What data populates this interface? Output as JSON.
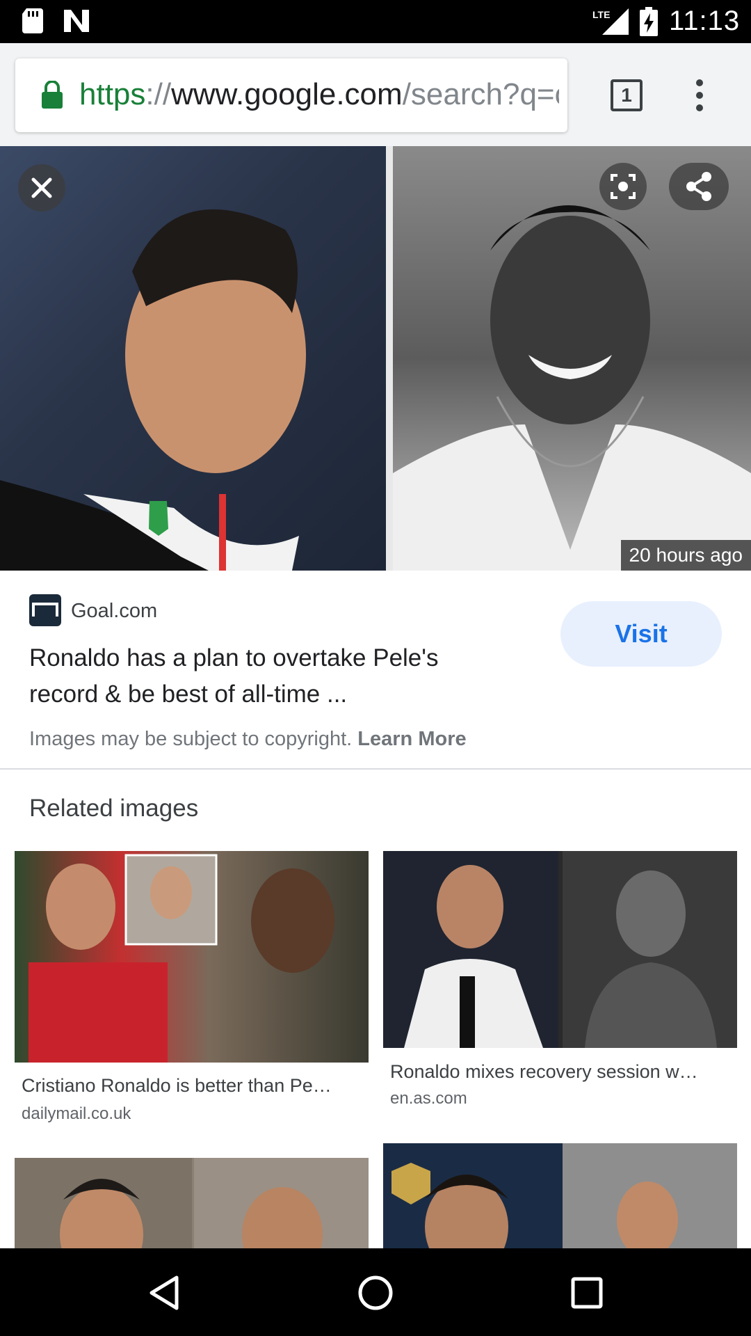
{
  "status_bar": {
    "time": "11:13",
    "network": "LTE",
    "icons": [
      "sd-card-icon",
      "n-notification-icon",
      "lte-signal-icon",
      "battery-charging-icon"
    ]
  },
  "browser": {
    "url_scheme": "https",
    "url_sep": "://",
    "url_host": "www.google.com",
    "url_path": "/search?q=c",
    "tab_count": "1",
    "colors": {
      "lock": "#188038",
      "scheme": "#188038"
    }
  },
  "viewer": {
    "timestamp": "20 hours ago",
    "buttons": [
      "close-icon",
      "lens-icon",
      "share-icon"
    ]
  },
  "result": {
    "site_name": "Goal.com",
    "title": "Ronaldo has a plan to overtake Pele's record & be best of all-time ...",
    "visit_label": "Visit",
    "copyright_text": "Images may be subject to copyright.",
    "learn_more": "Learn More"
  },
  "related": {
    "heading": "Related images",
    "items": [
      {
        "caption": "Cristiano Ronaldo is better than Pe…",
        "source": "dailymail.co.uk"
      },
      {
        "caption": "Ronaldo mixes recovery session w…",
        "source": "en.as.com"
      },
      {
        "caption": "",
        "source": ""
      },
      {
        "caption": "",
        "source": ""
      }
    ]
  },
  "nav": {
    "buttons": [
      "back-icon",
      "home-icon",
      "recents-icon"
    ]
  }
}
